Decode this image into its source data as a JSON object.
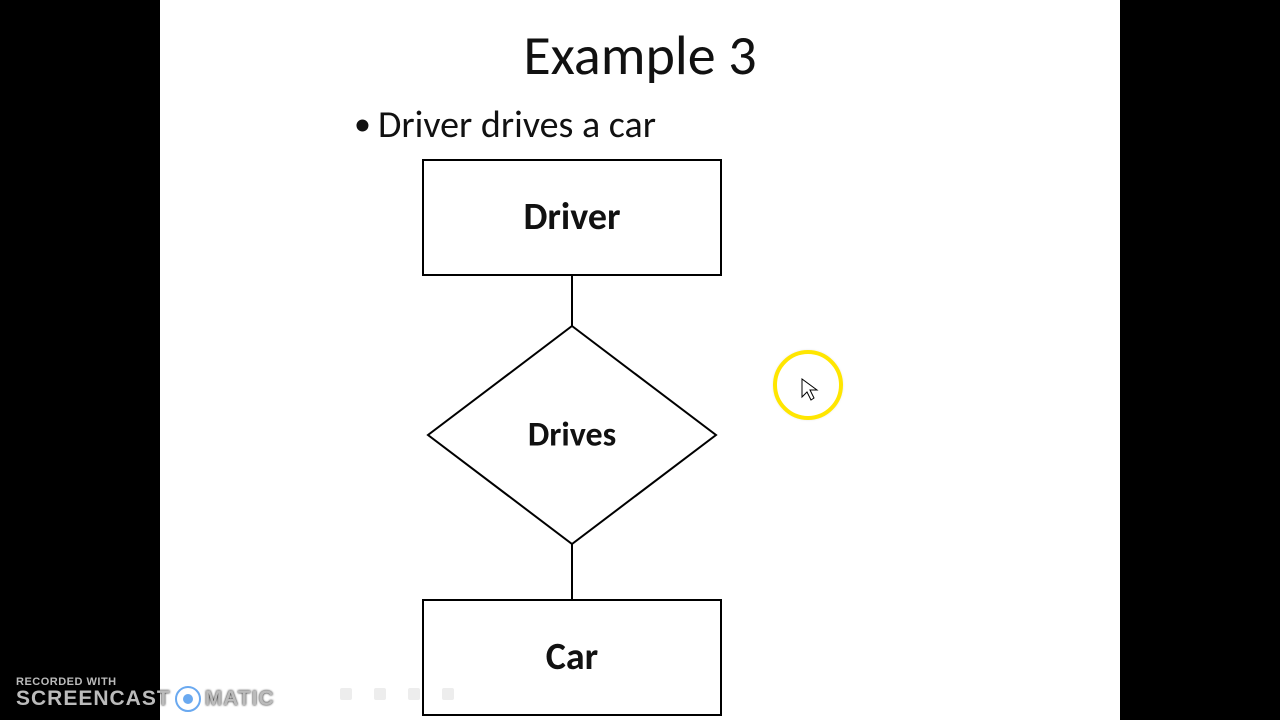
{
  "title": "Example 3",
  "bullet": "Driver drives a car",
  "entity_top": "Driver",
  "relationship": "Drives",
  "entity_bottom": "Car",
  "footer_rec": "RECORDED WITH",
  "footer_brand_left": "SCREENCAST",
  "footer_brand_right": "MATIC"
}
